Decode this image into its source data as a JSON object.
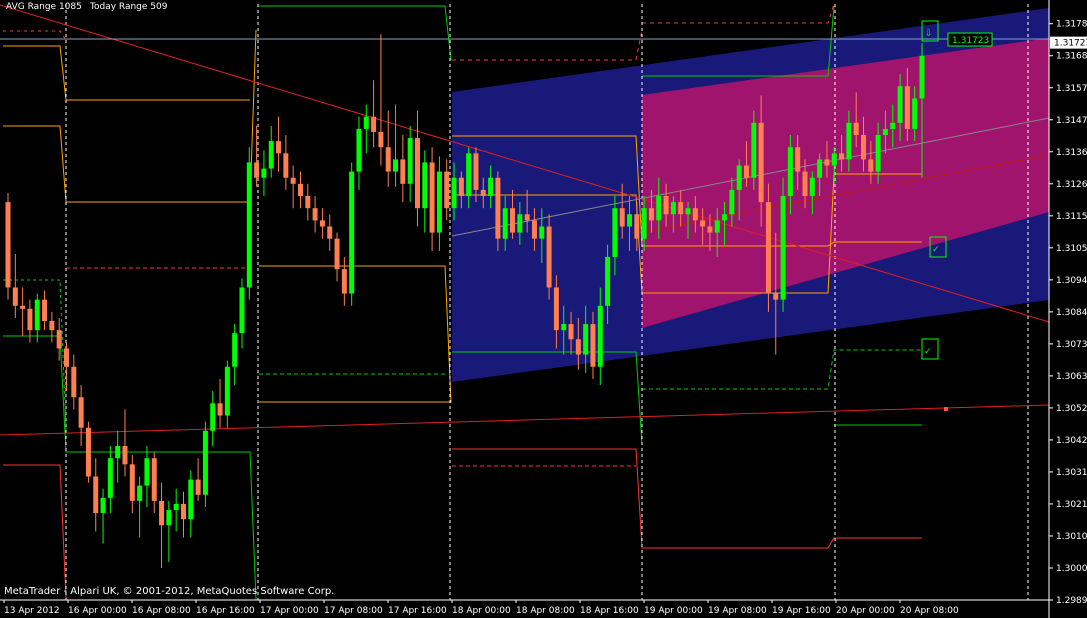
{
  "header": {
    "avg_range": "AVG Range 1085",
    "today_range": "Today Range 509"
  },
  "footer": {
    "copyright": "MetaTrader - Alpari UK, © 2001-2012, MetaQuotes Software Corp."
  },
  "price_tag": "1.31723",
  "colors": {
    "bull": "#00ff00",
    "bear": "#ff7f50",
    "upper_channel": "#a0146e",
    "lower_channel": "#19197a",
    "background": "#000000"
  },
  "chart_data": {
    "type": "candlestick",
    "symbol_timeframe": "",
    "ylim": [
      1.29895,
      1.3183
    ],
    "current_price": 1.31723,
    "y_ticks": [
      "1.31785",
      "1.31680",
      "1.31575",
      "1.31470",
      "1.31365",
      "1.31260",
      "1.31155",
      "1.31050",
      "1.30945",
      "1.30840",
      "1.30735",
      "1.30630",
      "1.30525",
      "1.30420",
      "1.30315",
      "1.30210",
      "1.30105",
      "1.30000",
      "1.29895"
    ],
    "x_ticks": [
      "13 Apr 2012",
      "16 Apr 00:00",
      "16 Apr 08:00",
      "16 Apr 16:00",
      "17 Apr 00:00",
      "17 Apr 08:00",
      "17 Apr 16:00",
      "18 Apr 00:00",
      "18 Apr 08:00",
      "18 Apr 16:00",
      "19 Apr 00:00",
      "19 Apr 08:00",
      "19 Apr 16:00",
      "20 Apr 00:00",
      "20 Apr 08:00"
    ],
    "candles": [
      [
        1.312,
        1.3123,
        1.3088,
        1.3092
      ],
      [
        1.3092,
        1.3103,
        1.3082,
        1.3086
      ],
      [
        1.3086,
        1.3092,
        1.3076,
        1.3085
      ],
      [
        1.3085,
        1.3088,
        1.3074,
        1.3078
      ],
      [
        1.3078,
        1.309,
        1.3074,
        1.3088
      ],
      [
        1.3088,
        1.3091,
        1.3078,
        1.3081
      ],
      [
        1.3081,
        1.3084,
        1.3074,
        1.3078
      ],
      [
        1.3078,
        1.3082,
        1.3068,
        1.3072
      ],
      [
        1.3072,
        1.3074,
        1.3058,
        1.3066
      ],
      [
        1.3066,
        1.307,
        1.3052,
        1.3056
      ],
      [
        1.3056,
        1.306,
        1.304,
        1.3046
      ],
      [
        1.3046,
        1.3048,
        1.3028,
        1.303
      ],
      [
        1.303,
        1.3036,
        1.3012,
        1.3018
      ],
      [
        1.3018,
        1.3026,
        1.3008,
        1.3023
      ],
      [
        1.3023,
        1.304,
        1.3018,
        1.3036
      ],
      [
        1.3036,
        1.3045,
        1.3028,
        1.304
      ],
      [
        1.304,
        1.3052,
        1.303,
        1.3034
      ],
      [
        1.3034,
        1.3037,
        1.3018,
        1.3022
      ],
      [
        1.3022,
        1.303,
        1.301,
        1.3027
      ],
      [
        1.3027,
        1.304,
        1.302,
        1.3036
      ],
      [
        1.3036,
        1.3038,
        1.3018,
        1.3022
      ],
      [
        1.3022,
        1.3028,
        1.3,
        1.3014
      ],
      [
        1.3014,
        1.3022,
        1.3002,
        1.3019
      ],
      [
        1.3019,
        1.3026,
        1.3012,
        1.3021
      ],
      [
        1.3021,
        1.3025,
        1.301,
        1.3016
      ],
      [
        1.3016,
        1.3032,
        1.301,
        1.3029
      ],
      [
        1.3029,
        1.3036,
        1.3022,
        1.3024
      ],
      [
        1.3024,
        1.3048,
        1.302,
        1.3045
      ],
      [
        1.3045,
        1.3058,
        1.304,
        1.3054
      ],
      [
        1.3054,
        1.3062,
        1.3046,
        1.305
      ],
      [
        1.305,
        1.3068,
        1.3046,
        1.3066
      ],
      [
        1.3066,
        1.308,
        1.306,
        1.3077
      ],
      [
        1.3077,
        1.3095,
        1.3072,
        1.3092
      ],
      [
        1.3092,
        1.3138,
        1.3088,
        1.3133
      ],
      [
        1.3133,
        1.3145,
        1.3125,
        1.3128
      ],
      [
        1.3128,
        1.3137,
        1.3122,
        1.3131
      ],
      [
        1.3131,
        1.3145,
        1.3128,
        1.314
      ],
      [
        1.314,
        1.3148,
        1.313,
        1.3136
      ],
      [
        1.3136,
        1.3142,
        1.3124,
        1.3128
      ],
      [
        1.3128,
        1.3132,
        1.3118,
        1.3126
      ],
      [
        1.3126,
        1.313,
        1.3118,
        1.3122
      ],
      [
        1.3122,
        1.3126,
        1.3114,
        1.3118
      ],
      [
        1.3118,
        1.3122,
        1.311,
        1.3114
      ],
      [
        1.3114,
        1.3118,
        1.3108,
        1.3112
      ],
      [
        1.3112,
        1.3116,
        1.3104,
        1.3108
      ],
      [
        1.3108,
        1.311,
        1.3094,
        1.3098
      ],
      [
        1.3098,
        1.3102,
        1.3086,
        1.309
      ],
      [
        1.309,
        1.3133,
        1.3086,
        1.313
      ],
      [
        1.313,
        1.3148,
        1.3124,
        1.3144
      ],
      [
        1.3144,
        1.3152,
        1.3136,
        1.3148
      ],
      [
        1.3148,
        1.316,
        1.3138,
        1.3143
      ],
      [
        1.3143,
        1.3175,
        1.3132,
        1.3138
      ],
      [
        1.3138,
        1.315,
        1.3125,
        1.313
      ],
      [
        1.313,
        1.3152,
        1.3125,
        1.3134
      ],
      [
        1.3134,
        1.3142,
        1.312,
        1.3126
      ],
      [
        1.3126,
        1.3145,
        1.312,
        1.3141
      ],
      [
        1.3141,
        1.315,
        1.3112,
        1.3118
      ],
      [
        1.3118,
        1.3137,
        1.311,
        1.3133
      ],
      [
        1.3133,
        1.3138,
        1.3104,
        1.311
      ],
      [
        1.311,
        1.3135,
        1.3104,
        1.313
      ],
      [
        1.313,
        1.3134,
        1.3114,
        1.3118
      ],
      [
        1.3118,
        1.3133,
        1.3114,
        1.3128
      ],
      [
        1.3128,
        1.313,
        1.3118,
        1.3122
      ],
      [
        1.3122,
        1.3138,
        1.3118,
        1.3136
      ],
      [
        1.3136,
        1.3138,
        1.312,
        1.3124
      ],
      [
        1.3124,
        1.3128,
        1.3118,
        1.3122
      ],
      [
        1.3122,
        1.3132,
        1.3118,
        1.3128
      ],
      [
        1.3128,
        1.313,
        1.3104,
        1.3108
      ],
      [
        1.3108,
        1.3122,
        1.3104,
        1.3118
      ],
      [
        1.3118,
        1.3124,
        1.3108,
        1.311
      ],
      [
        1.311,
        1.312,
        1.3106,
        1.3116
      ],
      [
        1.3116,
        1.3124,
        1.311,
        1.3114
      ],
      [
        1.3114,
        1.3118,
        1.3104,
        1.3108
      ],
      [
        1.3108,
        1.3118,
        1.31,
        1.3112
      ],
      [
        1.3112,
        1.3116,
        1.3088,
        1.3092
      ],
      [
        1.3092,
        1.3096,
        1.3072,
        1.3078
      ],
      [
        1.3078,
        1.3086,
        1.307,
        1.308
      ],
      [
        1.308,
        1.3084,
        1.307,
        1.3075
      ],
      [
        1.3075,
        1.3082,
        1.3065,
        1.307
      ],
      [
        1.307,
        1.3086,
        1.3064,
        1.308
      ],
      [
        1.308,
        1.3084,
        1.3062,
        1.3066
      ],
      [
        1.3066,
        1.3092,
        1.306,
        1.3086
      ],
      [
        1.3086,
        1.3106,
        1.308,
        1.3102
      ],
      [
        1.3102,
        1.3122,
        1.3096,
        1.3118
      ],
      [
        1.3118,
        1.3126,
        1.3108,
        1.3112
      ],
      [
        1.3112,
        1.3122,
        1.3104,
        1.3116
      ],
      [
        1.3116,
        1.312,
        1.3104,
        1.3108
      ],
      [
        1.3108,
        1.3122,
        1.3104,
        1.3118
      ],
      [
        1.3118,
        1.3124,
        1.311,
        1.3114
      ],
      [
        1.3114,
        1.3128,
        1.3108,
        1.3122
      ],
      [
        1.3122,
        1.3126,
        1.3112,
        1.3116
      ],
      [
        1.3116,
        1.3122,
        1.311,
        1.312
      ],
      [
        1.312,
        1.3124,
        1.3112,
        1.3116
      ],
      [
        1.3116,
        1.312,
        1.3108,
        1.3118
      ],
      [
        1.3118,
        1.3122,
        1.311,
        1.3114
      ],
      [
        1.3114,
        1.3118,
        1.3106,
        1.3112
      ],
      [
        1.3112,
        1.3116,
        1.3104,
        1.311
      ],
      [
        1.311,
        1.3118,
        1.3102,
        1.3114
      ],
      [
        1.3114,
        1.312,
        1.3106,
        1.3116
      ],
      [
        1.3116,
        1.3128,
        1.3112,
        1.3124
      ],
      [
        1.3124,
        1.3134,
        1.3114,
        1.3132
      ],
      [
        1.3132,
        1.314,
        1.3125,
        1.3128
      ],
      [
        1.3128,
        1.315,
        1.3124,
        1.3146
      ],
      [
        1.3146,
        1.3155,
        1.3112,
        1.312
      ],
      [
        1.312,
        1.3126,
        1.3084,
        1.309
      ],
      [
        1.309,
        1.311,
        1.307,
        1.3088
      ],
      [
        1.3088,
        1.3128,
        1.3084,
        1.3122
      ],
      [
        1.3122,
        1.3142,
        1.3116,
        1.3138
      ],
      [
        1.3138,
        1.3142,
        1.3124,
        1.313
      ],
      [
        1.313,
        1.3134,
        1.3118,
        1.3122
      ],
      [
        1.3122,
        1.313,
        1.3116,
        1.3128
      ],
      [
        1.3128,
        1.3136,
        1.3122,
        1.3134
      ],
      [
        1.3134,
        1.314,
        1.3128,
        1.3132
      ],
      [
        1.3132,
        1.3138,
        1.3126,
        1.3136
      ],
      [
        1.3136,
        1.3142,
        1.313,
        1.3134
      ],
      [
        1.3134,
        1.315,
        1.313,
        1.3146
      ],
      [
        1.3146,
        1.3156,
        1.3138,
        1.3142
      ],
      [
        1.3142,
        1.3148,
        1.313,
        1.3134
      ],
      [
        1.3134,
        1.314,
        1.3126,
        1.313
      ],
      [
        1.313,
        1.3146,
        1.3126,
        1.3142
      ],
      [
        1.3142,
        1.315,
        1.3136,
        1.3144
      ],
      [
        1.3144,
        1.3152,
        1.3138,
        1.3146
      ],
      [
        1.3146,
        1.3162,
        1.314,
        1.3158
      ],
      [
        1.3158,
        1.3164,
        1.314,
        1.3144
      ],
      [
        1.3144,
        1.3158,
        1.314,
        1.3154
      ],
      [
        1.3154,
        1.3172,
        1.3128,
        1.3168
      ]
    ],
    "projection_levels": [
      1.3108,
      1.3073
    ],
    "projection_marks": [
      "✓",
      "✓"
    ],
    "arrow_mark": "⇩"
  }
}
